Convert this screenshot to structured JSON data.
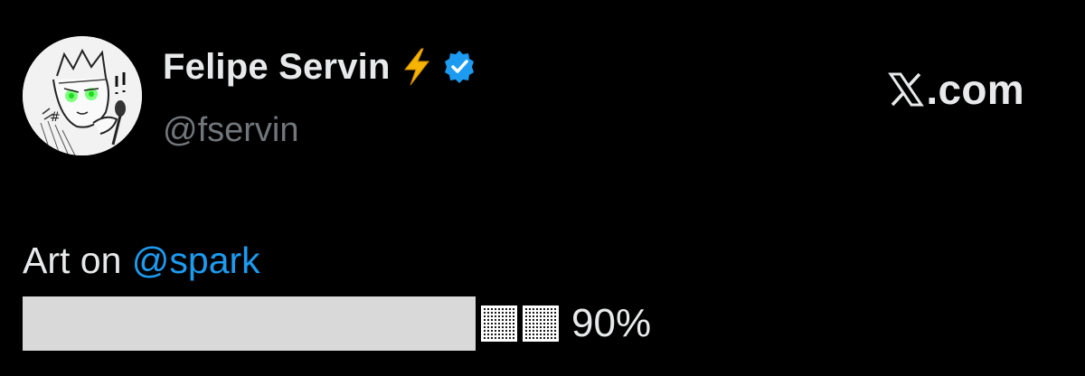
{
  "author": {
    "display_name": "Felipe Servin",
    "name_emoji": "bolt-emoji",
    "verified_badge": "verified-badge-icon",
    "handle": "@fservin"
  },
  "brand": {
    "logo": "x-logo-icon",
    "domain": ".com"
  },
  "post": {
    "text_prefix": "Art on ",
    "mention": "@spark",
    "progress": {
      "filled_fraction": 0.9,
      "empty_blocks": 2,
      "percent_label": "90%"
    }
  },
  "colors": {
    "background": "#000000",
    "text_primary": "#e7e9ea",
    "text_secondary": "#71767b",
    "mention": "#1d9bf0",
    "verified": "#1d9bf0",
    "bolt": "#f4b400",
    "progress_fill": "#d9d9d9"
  }
}
